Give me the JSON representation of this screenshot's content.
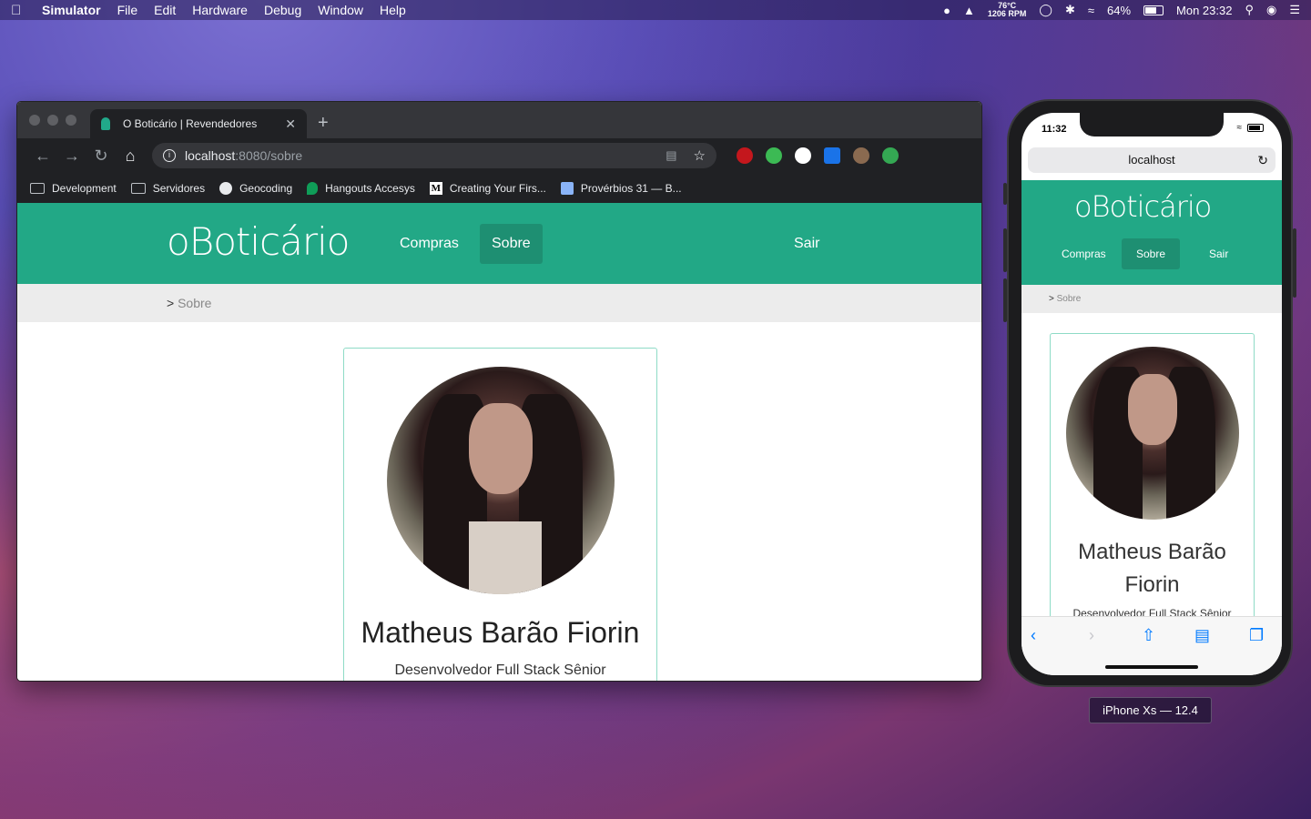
{
  "menubar": {
    "app_name": "Simulator",
    "items": [
      "File",
      "Edit",
      "Hardware",
      "Debug",
      "Window",
      "Help"
    ],
    "temp": "76°C",
    "rpm": "1206 RPM",
    "battery": "64%",
    "clock": "Mon 23:32"
  },
  "browser": {
    "tab_title": "O Boticário | Revendedores",
    "url_host": "localhost",
    "url_path": ":8080/sobre",
    "bookmarks": [
      "Development",
      "Servidores",
      "Geocoding",
      "Hangouts Accesys",
      "Creating Your Firs...",
      "Provérbios 31 — B..."
    ]
  },
  "site": {
    "logo": "oBoticário",
    "nav": {
      "compras": "Compras",
      "sobre": "Sobre",
      "sair": "Sair"
    },
    "breadcrumb_sep": ">",
    "breadcrumb_current": "Sobre",
    "profile": {
      "name": "Matheus Barão Fiorin",
      "role": "Desenvolvedor Full Stack Sênior"
    }
  },
  "iphone": {
    "time": "11:32",
    "address": "localhost",
    "name_line1": "Matheus Barão",
    "name_line2": "Fiorin",
    "role": "Desenvolvedor Full Stack Sênior"
  },
  "simulator_label": "iPhone Xs — 12.4",
  "colors": {
    "brand_green": "#22a886",
    "active_nav": "#1e8f72",
    "card_border": "#8edbc6"
  }
}
